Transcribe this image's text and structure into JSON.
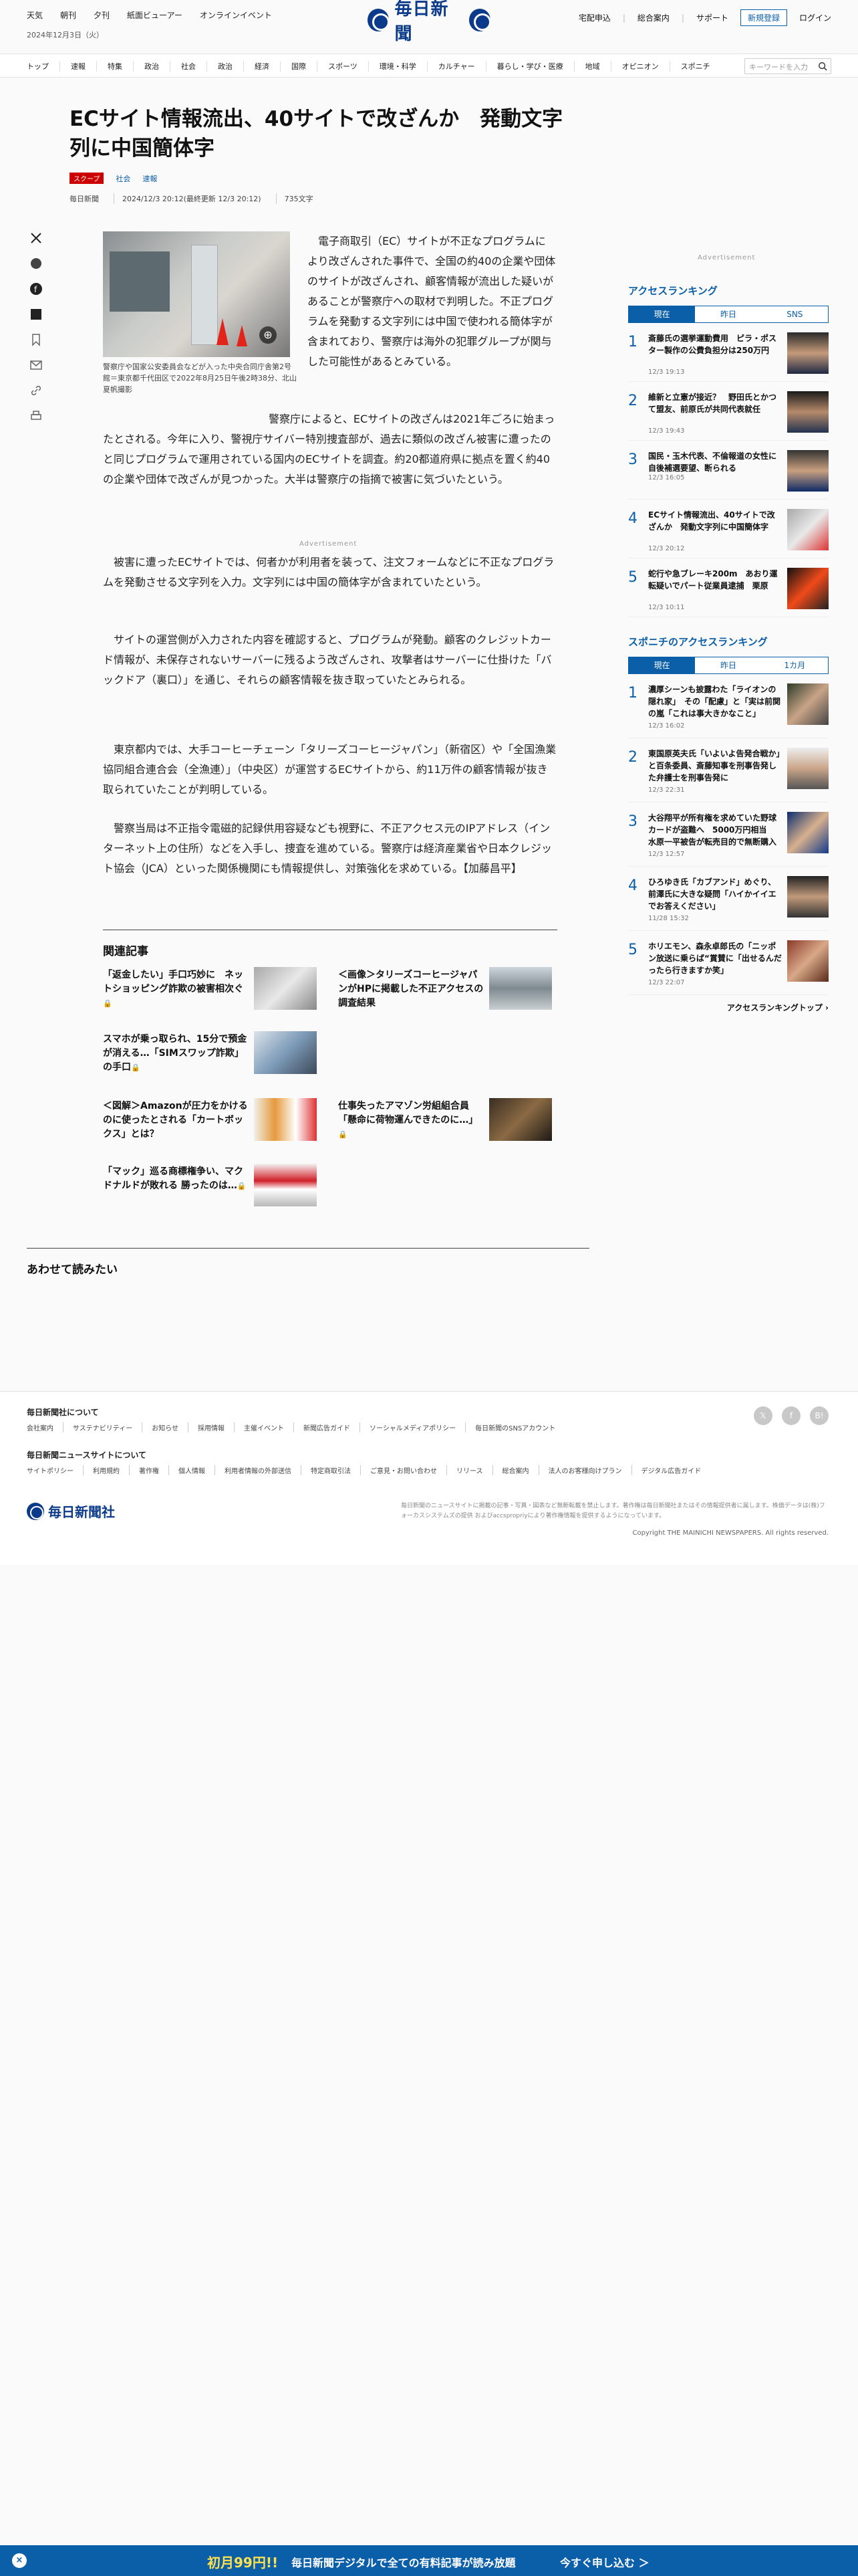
{
  "header": {
    "top_links": [
      "天気",
      "朝刊",
      "夕刊",
      "紙面ビューアー",
      "オンラインイベント"
    ],
    "date": "2024年12月3日（火）",
    "logo_text": "毎日新聞",
    "right_links": [
      "宅配申込",
      "総合案内",
      "サポート"
    ],
    "register_label": "新規登録",
    "login_label": "ログイン",
    "nav": [
      "トップ",
      "速報",
      "特集",
      "政治",
      "社会",
      "政治",
      "経済",
      "国際",
      "スポーツ",
      "環境・科学",
      "カルチャー",
      "暮らし・学び・医療",
      "地域",
      "オピニオン",
      "スポニチ"
    ],
    "search_placeholder": "キーワードを入力"
  },
  "article": {
    "headline": "ECサイト情報流出、40サイトで改ざんか　発動文字列に中国簡体字",
    "tag_scoop": "スクープ",
    "categories": [
      "社会",
      "速報"
    ],
    "meta": [
      "毎日新聞",
      "2024/12/3 20:12(最終更新 12/3 20:12)",
      "735文字"
    ],
    "caption": "警察庁や国家公安委員会などが入った中央合同庁舎第2号館＝東京都千代田区で2022年8月25日午後2時38分、北山夏帆撮影",
    "paragraphs": [
      "電子商取引（EC）サイトが不正なプログラムにより改ざんされた事件で、全国の約40の企業や団体のサイトが改ざんされ、顧客情報が流出した疑いがあることが警察庁への取材で判明した。不正プログラムを発動する文字列には中国で使われる簡体字が含まれており、警察庁は海外の犯罪グループが関与した可能性があるとみている。",
      "警察庁によると、ECサイトの改ざんは2021年ごろに始まったとされる。今年に入り、警視庁サイバー特別捜査部が、過去に類似の改ざん被害に遭ったのと同じプログラムで運用されている国内のECサイトを調査。約20都道府県に拠点を置く約40の企業や団体で改ざんが見つかった。大半は警察庁の指摘で被害に気づいたという。",
      "被害に遭ったECサイトでは、何者かが利用者を装って、注文フォームなどに不正なプログラムを発動させる文字列を入力。文字列には中国の簡体字が含まれていたという。",
      "サイトの運営側が入力された内容を確認すると、プログラムが発動。顧客のクレジットカード情報が、未保存されないサーバーに残るよう改ざんされ、攻撃者はサーバーに仕掛けた「バックドア（裏口）」を通じ、それらの顧客情報を抜き取っていたとみられる。",
      "東京都内では、大手コーヒーチェーン「タリーズコーヒージャパン」（新宿区）や「全国漁業協同組合連合会（全漁連）」（中央区）が運営するECサイトから、約11万件の顧客情報が抜き取られていたことが判明している。",
      "警察当局は不正指令電磁的記録供用容疑なども視野に、不正アクセス元のIPアドレス（インターネット上の住所）などを入手し、捜査を進めている。警察庁は経済産業省や日本クレジット協会（JCA）といった関係機関にも情報提供し、対策強化を求めている。【加藤昌平】"
    ],
    "ad_label": "Advertisement"
  },
  "related": {
    "title": "関連記事",
    "items": [
      {
        "title": "「返金したい」手口巧妙に　ネットショッピング詐欺の被害相次ぐ",
        "lock": "🔒"
      },
      {
        "title": "＜画像＞タリーズコーヒージャパンがHPに掲載した不正アクセスの調査結果",
        "lock": ""
      },
      {
        "title": "スマホが乗っ取られ、15分で預金が消える…「SIMスワップ詐欺」の手口",
        "lock": "🔒"
      },
      {
        "title": "＜図解＞Amazonが圧力をかけるのに使ったとされる「カートボックス」とは？",
        "lock": ""
      },
      {
        "title": "仕事失ったアマゾン労組組合員「懸命に荷物運んできたのに…」",
        "lock": "🔒"
      },
      {
        "title": "「マック」巡る商標権争い、マクドナルドが敗れる 勝ったのは…",
        "lock": "🔒"
      }
    ]
  },
  "also_read": "あわせて読みたい",
  "sidebar": {
    "ad_label": "Advertisement",
    "ranking1": {
      "title": "アクセスランキング",
      "tabs": [
        "現在",
        "昨日",
        "SNS"
      ],
      "items": [
        {
          "n": "1",
          "title": "斎藤氏の選挙運動費用　ピラ・ポスター製作の公費負担分は250万円",
          "date": "12/3 19:13"
        },
        {
          "n": "2",
          "title": "維新と立憲が接近？　野田氏とかつて盟友、前原氏が共同代表就任",
          "date": "12/3 19:43"
        },
        {
          "n": "3",
          "title": "国民・玉木代表、不倫報道の女性に自後補選要望、断られる",
          "date": "12/3 16:05"
        },
        {
          "n": "4",
          "title": "ECサイト情報流出、40サイトで改ざんか　発動文字列に中国簡体字",
          "date": "12/3 20:12"
        },
        {
          "n": "5",
          "title": "蛇行や急ブレーキ200m　あおり運転疑いでパート従業員逮捕　栗原",
          "date": "12/3 10:11"
        }
      ]
    },
    "ranking2": {
      "title": "スポニチのアクセスランキング",
      "tabs": [
        "現在",
        "昨日",
        "1カ月"
      ],
      "items": [
        {
          "n": "1",
          "title": "濃厚シーンも披露わた「ライオンの隠れ家」　その「配慮」と「実は前関の嵐「これは事大きかなこと」",
          "date": "12/3 16:02"
        },
        {
          "n": "2",
          "title": "東国原英夫氏「いよいよ告発合戦か」と百条委員、斎藤知事を刑事告発した弁護士を刑事告発に",
          "date": "12/3 22:31"
        },
        {
          "n": "3",
          "title": "大谷翔平が所有権を求めていた野球カードが盗難へ　5000万円相当　水原一平被告が転売目的で無断購入",
          "date": "12/3 12:57"
        },
        {
          "n": "4",
          "title": "ひろゆき氏「カブアンド」めぐり、前澤氏に大きな疑問「ハイかイイエでお答えください」",
          "date": "11/28 15:32"
        },
        {
          "n": "5",
          "title": "ホリエモン、森永卓郎氏の「ニッポン放送に乗らば“賞賛に「出せるんだったら行きますか笑」",
          "date": "12/3 22:07"
        }
      ]
    },
    "more_label": "アクセスランキングトップ ›"
  },
  "footer": {
    "about_title": "毎日新聞社について",
    "about_links": [
      "会社案内",
      "サステナビリティー",
      "お知らせ",
      "採用情報",
      "主催イベント",
      "新聞広告ガイド",
      "ソーシャルメディアポリシー",
      "毎日新聞のSNSアカウント"
    ],
    "site_title": "毎日新聞ニュースサイトについて",
    "site_links": [
      "サイトポリシー",
      "利用規約",
      "著作権",
      "個人情報",
      "利用者情報の外部送信",
      "特定商取引法",
      "ご意見・お問い合わせ",
      "リリース",
      "総合案内",
      "法人のお客様向けプラン",
      "デジタル広告ガイド"
    ],
    "logo_text": "毎日新聞社",
    "note": "毎日新聞のニュースサイトに掲載の記事・写真・図表など無断転載を禁止します。著作権は毎日新聞社またはその情報提供者に属します。株価データは(株)フォーカスシステムズの提供 およびaccspropriyにより著作権情報を提供するようになっています。",
    "copyright": "Copyright THE MAINICHI NEWSPAPERS. All rights reserved."
  },
  "banner": {
    "close": "×",
    "big": "初月99円!!",
    "mid": "毎日新聞デジタルで全ての有料記事が読み放題",
    "cta": "今すぐ申し込む ＞"
  }
}
